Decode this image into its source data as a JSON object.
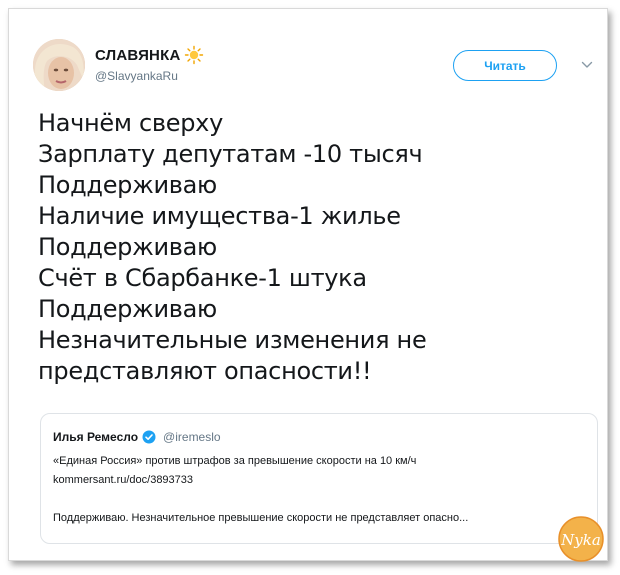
{
  "profile": {
    "display_name": "СЛАВЯНКА",
    "handle": "@SlavyankaRu",
    "name_emoji_icon": "sun-icon"
  },
  "header": {
    "follow_label": "Читать",
    "menu_icon": "chevron-down-icon"
  },
  "tweet": {
    "lines": [
      "Начнём сверху",
      "Зарплату депутатам -10 тысяч",
      "Поддерживаю",
      "Наличие имущества-1 жилье",
      "Поддерживаю",
      "Счёт в Сбарбанке-1 штука",
      "Поддерживаю",
      "Незначительные изменения не",
      "представляют опасности!!"
    ]
  },
  "quote": {
    "name": "Илья Ремесло",
    "handle": "@iremeslo",
    "verified_icon": "verified-badge-icon",
    "body_lines": [
      "«Единая Россия» против штрафов за превышение скорости на 10 км/ч",
      "kommersant.ru/doc/3893733"
    ],
    "reply_text": "Поддерживаю. Незначительное превышение скорости не представляет опасно..."
  },
  "watermark": {
    "logo_text": "Nyka"
  },
  "colors": {
    "accent": "#1da1f2",
    "text": "#14171a",
    "secondary_text": "#657786",
    "border": "#dfe3e7",
    "watermark": "#f0a23a"
  }
}
